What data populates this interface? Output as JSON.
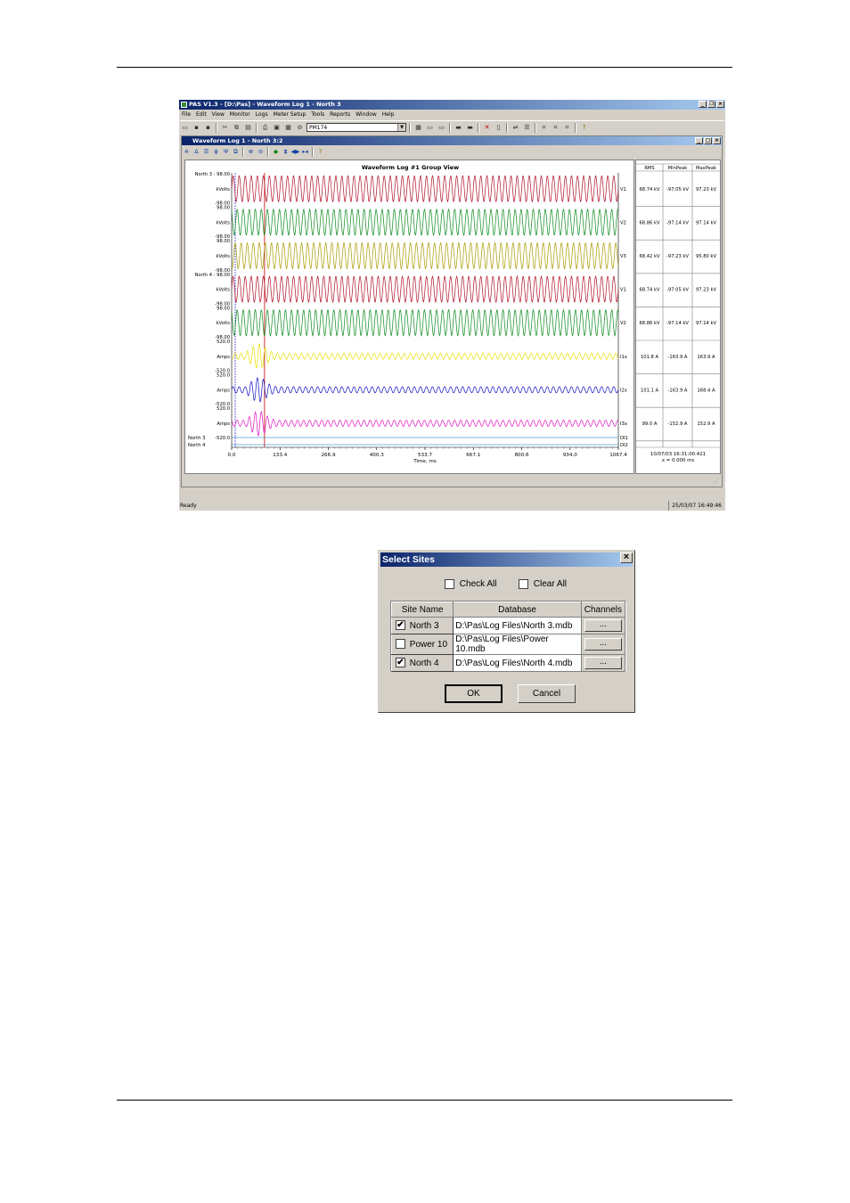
{
  "app": {
    "title": "PAS V1.3 - [D:\\Pas] - Waveform Log 1 - North 3",
    "menu": [
      "File",
      "Edit",
      "View",
      "Monitor",
      "Logs",
      "Meter Setup",
      "Tools",
      "Reports",
      "Window",
      "Help"
    ],
    "device_combo": "PM174",
    "status_left": "Ready",
    "status_right": "25/03/07 16:49:46"
  },
  "child": {
    "title": "Waveform Log 1 - North 3:2",
    "plot_title": "Waveform Log #1 Group View",
    "xlabel": "Time, ms",
    "xticks": [
      "0.0",
      "133.4",
      "266.9",
      "400.3",
      "533.7",
      "667.1",
      "800.6",
      "934.0",
      "1067.4"
    ],
    "channels": [
      {
        "site": "North 3",
        "top": "98.00",
        "unit": "kVolts",
        "bottom": "-98.00",
        "name": "V1",
        "color": "#b01028",
        "rms": "68.74 kV",
        "min": "-97.05 kV",
        "max": "97.23 kV"
      },
      {
        "site": "",
        "top": "98.00",
        "unit": "kVolts",
        "bottom": "-98.00",
        "name": "V2",
        "color": "#0a8a1e",
        "rms": "68.86 kV",
        "min": "-97.14 kV",
        "max": "97.14 kV"
      },
      {
        "site": "",
        "top": "98.00",
        "unit": "kVolts",
        "bottom": "-98.00",
        "name": "V3",
        "color": "#a89a00",
        "rms": "68.42 kV",
        "min": "-97.23 kV",
        "max": "95.80 kV"
      },
      {
        "site": "North 4",
        "top": "98.00",
        "unit": "kVolts",
        "bottom": "-98.00",
        "name": "V1",
        "color": "#b01028",
        "rms": "68.74 kV",
        "min": "-97.05 kV",
        "max": "97.23 kV"
      },
      {
        "site": "",
        "top": "98.00",
        "unit": "kVolts",
        "bottom": "-98.00",
        "name": "V2",
        "color": "#0a8a1e",
        "rms": "68.86 kV",
        "min": "-97.14 kV",
        "max": "97.14 kV"
      },
      {
        "site": "",
        "top": "520.0",
        "unit": "Amps",
        "bottom": "-520.0",
        "name": "I1x",
        "color": "#e8e000",
        "rms": "101.8 A",
        "min": "-163.9 A",
        "max": "163.9 A"
      },
      {
        "site": "",
        "top": "520.0",
        "unit": "Amps",
        "bottom": "-520.0",
        "name": "I2x",
        "color": "#1010c0",
        "rms": "101.1 A",
        "min": "-163.9 A",
        "max": "168.4 A"
      },
      {
        "site": "",
        "top": "520.0",
        "unit": "Amps",
        "bottom": "-520.0",
        "name": "I3x",
        "color": "#e010c0",
        "rms": "99.0 A",
        "min": "-152.9 A",
        "max": "152.9 A"
      }
    ],
    "digital": [
      {
        "site": "North 3",
        "name": "DI1"
      },
      {
        "site": "North 4",
        "name": "DI2"
      }
    ],
    "table_headers": [
      "RMS",
      "MinPeak",
      "MaxPeak"
    ],
    "timestamp": "10/07/03 16:31:00.421",
    "cursor": "x = 0.000 ms"
  },
  "dialog": {
    "title": "Select Sites",
    "close": "×",
    "check_all": "Check All",
    "clear_all": "Clear All",
    "headers": [
      "Site Name",
      "Database",
      "Channels"
    ],
    "rows": [
      {
        "checked": true,
        "site": "North 3",
        "db": "D:\\Pas\\Log Files\\North 3.mdb",
        "btn": "..."
      },
      {
        "checked": false,
        "site": "Power 10",
        "db": "D:\\Pas\\Log Files\\Power 10.mdb",
        "btn": "..."
      },
      {
        "checked": true,
        "site": "North 4",
        "db": "D:\\Pas\\Log Files\\North 4.mdb",
        "btn": "..."
      }
    ],
    "ok": "OK",
    "cancel": "Cancel"
  }
}
